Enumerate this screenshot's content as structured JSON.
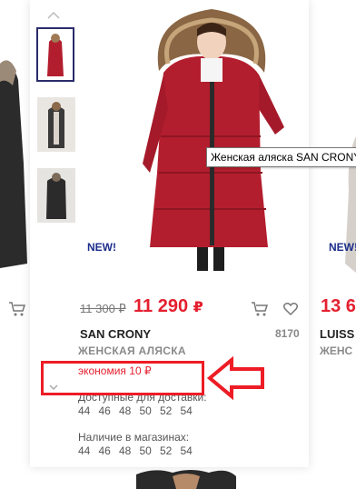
{
  "tooltip": "Женская аляска SAN CRONY",
  "product": {
    "old_price": "11 300 ₽",
    "new_price": "11 290",
    "currency": "₽",
    "brand": "SAN CRONY",
    "article": "8170",
    "title": "ЖЕНСКАЯ АЛЯСКА",
    "saving": "экономия 10 ₽",
    "delivery_label": "Доступные для доставки:",
    "delivery_sizes": [
      "44",
      "46",
      "48",
      "50",
      "52",
      "54"
    ],
    "store_label": "Наличие в магазинах:",
    "store_sizes": [
      "44",
      "46",
      "48",
      "50",
      "52",
      "54"
    ],
    "badge": "NEW!"
  },
  "right_product": {
    "price": "13 6",
    "brand": "LUISS",
    "title": "ЖЕНС",
    "badge": "NEW!"
  },
  "colors": {
    "accent_red": "#e4202f",
    "badge_blue": "#1c2d8c",
    "coat_red": "#b31e2e"
  }
}
